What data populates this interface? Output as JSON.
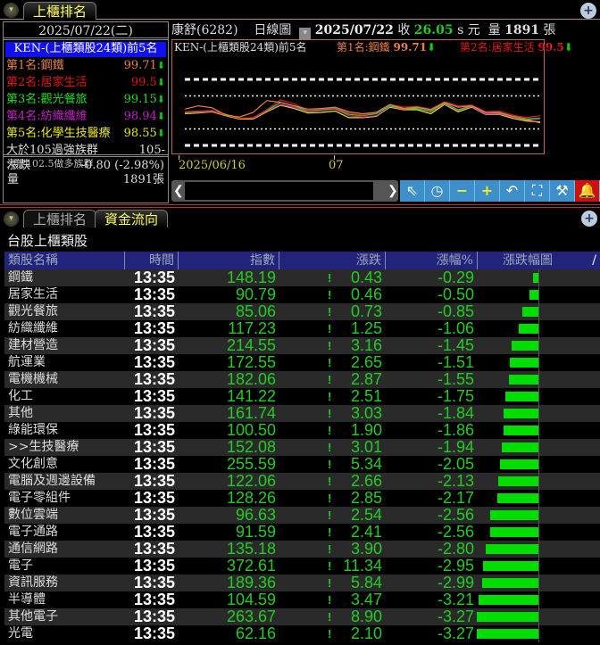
{
  "top_tab": "上櫃排名",
  "left": {
    "date": "2025/07/22(二)",
    "title": "KEN-(上櫃類股24類)前5名",
    "ranks": [
      {
        "label": "第1名:鋼鐵",
        "value": "99.71",
        "color": "#e8804a"
      },
      {
        "label": "第2名:居家生活",
        "value": "99.5",
        "color": "#e01818"
      },
      {
        "label": "第3名:觀光餐旅",
        "value": "99.15",
        "color": "#22dd22"
      },
      {
        "label": "第4名:紡織纖維",
        "value": "98.94",
        "color": "#c020c0"
      },
      {
        "label": "第5名:化學生技醫療",
        "value": "98.55",
        "color": "#e8e820"
      }
    ],
    "strong_label": "大於105過強族群",
    "strong_value": "105-",
    "bull_label": "大於102.5做多族群",
    "change_label": "漲跌",
    "change_value": "-0.80 (-2.98%)",
    "volume_label": "量",
    "volume_value": "1891張"
  },
  "chart_header": {
    "stock": "康舒(6282)",
    "period": "日線圖",
    "date": "2025/07/22",
    "close_label": "收",
    "close": "26.05",
    "close_suffix": "s 元",
    "vol_label": "量",
    "volume": "1891",
    "vol_unit": "張",
    "legend_title": "KEN-(上櫃類股24類)前5名",
    "legend1": "第1名:鋼鐵",
    "legend1_val": "99.71",
    "legend2": "第2名:居家生活",
    "legend2_val": "99.5"
  },
  "chart_data": {
    "type": "line",
    "x_labels": [
      "2025/06/16",
      "07"
    ],
    "ref_lines": [
      105,
      102.5,
      97.5,
      95
    ],
    "ylim": [
      94,
      106
    ],
    "series": [
      {
        "name": "鋼鐵",
        "color": "#e8804a",
        "values": [
          100.5,
          101,
          100.7,
          99.6,
          99.3,
          100,
          101.8,
          101.5,
          101,
          100.5,
          100.6,
          100.8,
          100.1,
          99.8,
          100,
          101.2,
          100.6,
          100.8,
          100.4,
          101.5,
          100.8,
          101,
          100,
          99.9,
          99.4,
          98.9,
          98.4
        ]
      },
      {
        "name": "居家生活",
        "color": "#e01818",
        "values": [
          100.1,
          100.2,
          100.3,
          99.6,
          99.1,
          99.2,
          100.4,
          101.9,
          101.3,
          100.3,
          100.5,
          100.7,
          99.9,
          99.6,
          100,
          101.2,
          100.8,
          100.9,
          100.5,
          101.6,
          101,
          101.1,
          100.1,
          100.2,
          99.6,
          99.2,
          99.5
        ]
      },
      {
        "name": "觀光餐旅",
        "color": "#22dd22",
        "values": [
          100,
          100.1,
          100.3,
          99.7,
          99.1,
          99.2,
          100.3,
          101.5,
          101,
          100.2,
          100.4,
          100.6,
          99.7,
          99.5,
          99.8,
          101,
          100.6,
          100.6,
          100.2,
          101.4,
          100.4,
          101,
          100,
          100,
          99.4,
          99,
          99.15
        ]
      },
      {
        "name": "紡織纖維",
        "color": "#c020c0",
        "values": [
          99.9,
          100,
          100.2,
          99.6,
          99.1,
          99.1,
          100.2,
          101.2,
          100.8,
          100.1,
          100.3,
          100.5,
          99.5,
          99.3,
          99.5,
          100.9,
          100.5,
          100.6,
          100.1,
          101.3,
          100.3,
          100.9,
          99.8,
          99.8,
          99.3,
          98.9,
          98.94
        ]
      },
      {
        "name": "化學生技醫療",
        "color": "#e8e820",
        "values": [
          99.8,
          99.9,
          100.1,
          99.5,
          99,
          99,
          100.1,
          101.1,
          100.6,
          99.9,
          100,
          100.2,
          99.2,
          99.2,
          99.4,
          100.8,
          100.4,
          100.4,
          99.8,
          101.2,
          100.1,
          100.8,
          99.7,
          99.7,
          99.1,
          98.7,
          98.55
        ]
      }
    ]
  },
  "tabs2": [
    "上櫃排名",
    "資金流向"
  ],
  "subtitle": "台股上櫃類股",
  "columns": [
    "類股名稱",
    "時間",
    "指數",
    "漲跌",
    "漲幅%",
    "漲跌幅圖"
  ],
  "sort_icon": "/",
  "rows": [
    {
      "name": "鋼鐵",
      "time": "13:35",
      "index": "148.19",
      "chg": "0.43",
      "pct": "-0.29",
      "pv": -0.29
    },
    {
      "name": "居家生活",
      "time": "13:35",
      "index": "90.79",
      "chg": "0.46",
      "pct": "-0.50",
      "pv": -0.5
    },
    {
      "name": "觀光餐旅",
      "time": "13:35",
      "index": "85.06",
      "chg": "0.73",
      "pct": "-0.85",
      "pv": -0.85
    },
    {
      "name": "紡織纖維",
      "time": "13:35",
      "index": "117.23",
      "chg": "1.25",
      "pct": "-1.06",
      "pv": -1.06
    },
    {
      "name": "建材營造",
      "time": "13:35",
      "index": "214.55",
      "chg": "3.16",
      "pct": "-1.45",
      "pv": -1.45
    },
    {
      "name": "航運業",
      "time": "13:35",
      "index": "172.55",
      "chg": "2.65",
      "pct": "-1.51",
      "pv": -1.51
    },
    {
      "name": "電機機械",
      "time": "13:35",
      "index": "182.06",
      "chg": "2.87",
      "pct": "-1.55",
      "pv": -1.55
    },
    {
      "name": "化工",
      "time": "13:35",
      "index": "141.22",
      "chg": "2.51",
      "pct": "-1.75",
      "pv": -1.75
    },
    {
      "name": "其他",
      "time": "13:35",
      "index": "161.74",
      "chg": "3.03",
      "pct": "-1.84",
      "pv": -1.84
    },
    {
      "name": "綠能環保",
      "time": "13:35",
      "index": "100.50",
      "chg": "1.90",
      "pct": "-1.86",
      "pv": -1.86
    },
    {
      "name": ">>生技醫療",
      "time": "13:35",
      "index": "152.08",
      "chg": "3.01",
      "pct": "-1.94",
      "pv": -1.94
    },
    {
      "name": "文化創意",
      "time": "13:35",
      "index": "255.59",
      "chg": "5.34",
      "pct": "-2.05",
      "pv": -2.05
    },
    {
      "name": "電腦及週邊設備",
      "time": "13:35",
      "index": "122.06",
      "chg": "2.66",
      "pct": "-2.13",
      "pv": -2.13
    },
    {
      "name": "電子零組件",
      "time": "13:35",
      "index": "128.26",
      "chg": "2.85",
      "pct": "-2.17",
      "pv": -2.17
    },
    {
      "name": "數位雲端",
      "time": "13:35",
      "index": "96.63",
      "chg": "2.54",
      "pct": "-2.56",
      "pv": -2.56
    },
    {
      "name": "電子通路",
      "time": "13:35",
      "index": "91.59",
      "chg": "2.41",
      "pct": "-2.56",
      "pv": -2.56
    },
    {
      "name": "通信網路",
      "time": "13:35",
      "index": "135.18",
      "chg": "3.90",
      "pct": "-2.80",
      "pv": -2.8
    },
    {
      "name": "電子",
      "time": "13:35",
      "index": "372.61",
      "chg": "11.34",
      "pct": "-2.95",
      "pv": -2.95
    },
    {
      "name": "資訊服務",
      "time": "13:35",
      "index": "189.36",
      "chg": "5.84",
      "pct": "-2.99",
      "pv": -2.99
    },
    {
      "name": "半導體",
      "time": "13:35",
      "index": "104.59",
      "chg": "3.47",
      "pct": "-3.21",
      "pv": -3.21
    },
    {
      "name": "其他電子",
      "time": "13:35",
      "index": "263.67",
      "chg": "8.90",
      "pct": "-3.27",
      "pv": -3.27
    },
    {
      "name": "光電",
      "time": "13:35",
      "index": "62.16",
      "chg": "2.10",
      "pct": "-3.27",
      "pv": -3.27
    }
  ]
}
